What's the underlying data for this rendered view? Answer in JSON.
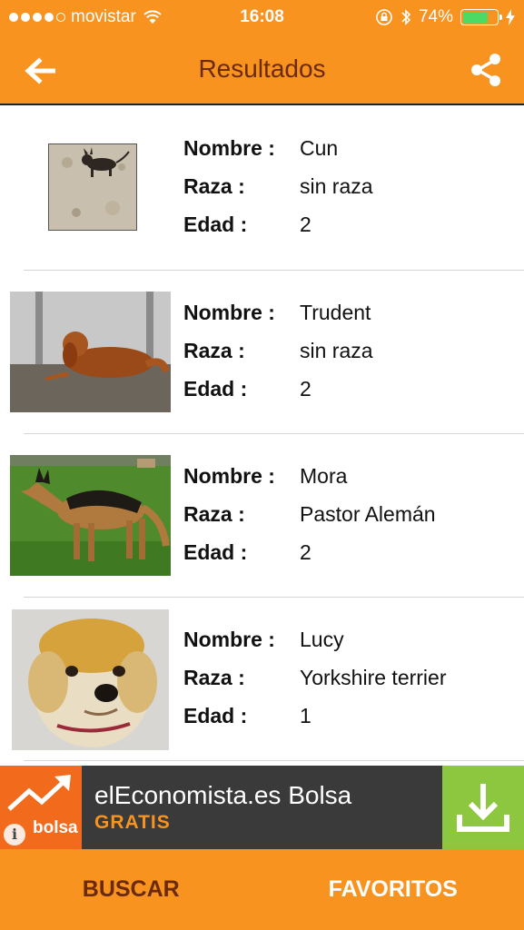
{
  "status": {
    "carrier": "movistar",
    "time": "16:08",
    "battery_text": "74%",
    "battery_level": 0.74
  },
  "nav": {
    "title": "Resultados"
  },
  "results": [
    {
      "nombre_label": "Nombre :",
      "raza_label": "Raza :",
      "edad_label": "Edad :",
      "nombre": "Cun",
      "raza": "sin raza",
      "edad": "2"
    },
    {
      "nombre_label": "Nombre :",
      "raza_label": "Raza :",
      "edad_label": "Edad :",
      "nombre": "Trudent",
      "raza": "sin raza",
      "edad": "2"
    },
    {
      "nombre_label": "Nombre :",
      "raza_label": "Raza :",
      "edad_label": "Edad :",
      "nombre": "Mora",
      "raza": "Pastor Alemán",
      "edad": "2"
    },
    {
      "nombre_label": "Nombre :",
      "raza_label": "Raza :",
      "edad_label": "Edad :",
      "nombre": "Lucy",
      "raza": "Yorkshire terrier",
      "edad": "1"
    }
  ],
  "ad": {
    "logo_text": "bolsa",
    "title": "elEconomista.es Bolsa",
    "subtitle": "GRATIS"
  },
  "tabs": {
    "buscar": "BUSCAR",
    "favoritos": "FAVORITOS"
  },
  "colors": {
    "brand_orange": "#f7931e",
    "title_brown": "#6b2a0c",
    "ad_green": "#8dc63f",
    "ad_orange": "#f26b1d"
  }
}
